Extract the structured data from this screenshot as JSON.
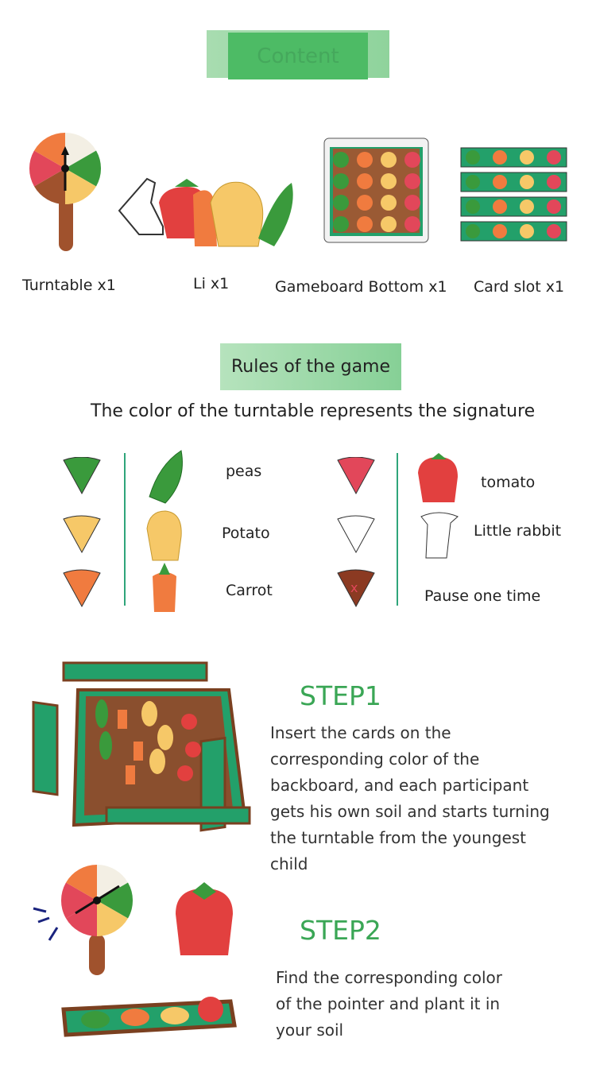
{
  "header": {
    "title": "Content"
  },
  "contents": [
    {
      "label": "Turntable x1",
      "icon": "turntable-icon"
    },
    {
      "label": "Li x1",
      "icon": "vegetable-pieces-icon"
    },
    {
      "label": "Gameboard Bottom x1",
      "icon": "gameboard-icon"
    },
    {
      "label": "Card slot x1",
      "icon": "card-slot-icon"
    }
  ],
  "rules": {
    "title": "Rules of the game",
    "subtitle": "The color of the turntable represents the signature"
  },
  "legend": [
    {
      "color": "#3a9a3c",
      "label": "peas",
      "icon": "peas-icon"
    },
    {
      "color": "#f6c868",
      "label": "Potato",
      "icon": "potato-icon"
    },
    {
      "color": "#f07b3f",
      "label": "Carrot",
      "icon": "carrot-icon"
    },
    {
      "color": "#e2475a",
      "label": "tomato",
      "icon": "tomato-icon"
    },
    {
      "color": "#ffffff",
      "label": "Little rabbit",
      "icon": "rabbit-icon"
    },
    {
      "color": "#8b3a22",
      "label": "Pause one time",
      "icon": "pause-icon"
    }
  ],
  "steps": [
    {
      "title": "STEP1",
      "lines": [
        "Insert the cards on the",
        "corresponding color of the",
        "backboard, and each participant",
        "gets his own soil and starts turning",
        "the turntable from the youngest",
        "child"
      ]
    },
    {
      "title": "STEP2",
      "lines": [
        "Find the corresponding color",
        "of the pointer and plant it in",
        "your soil"
      ]
    }
  ]
}
